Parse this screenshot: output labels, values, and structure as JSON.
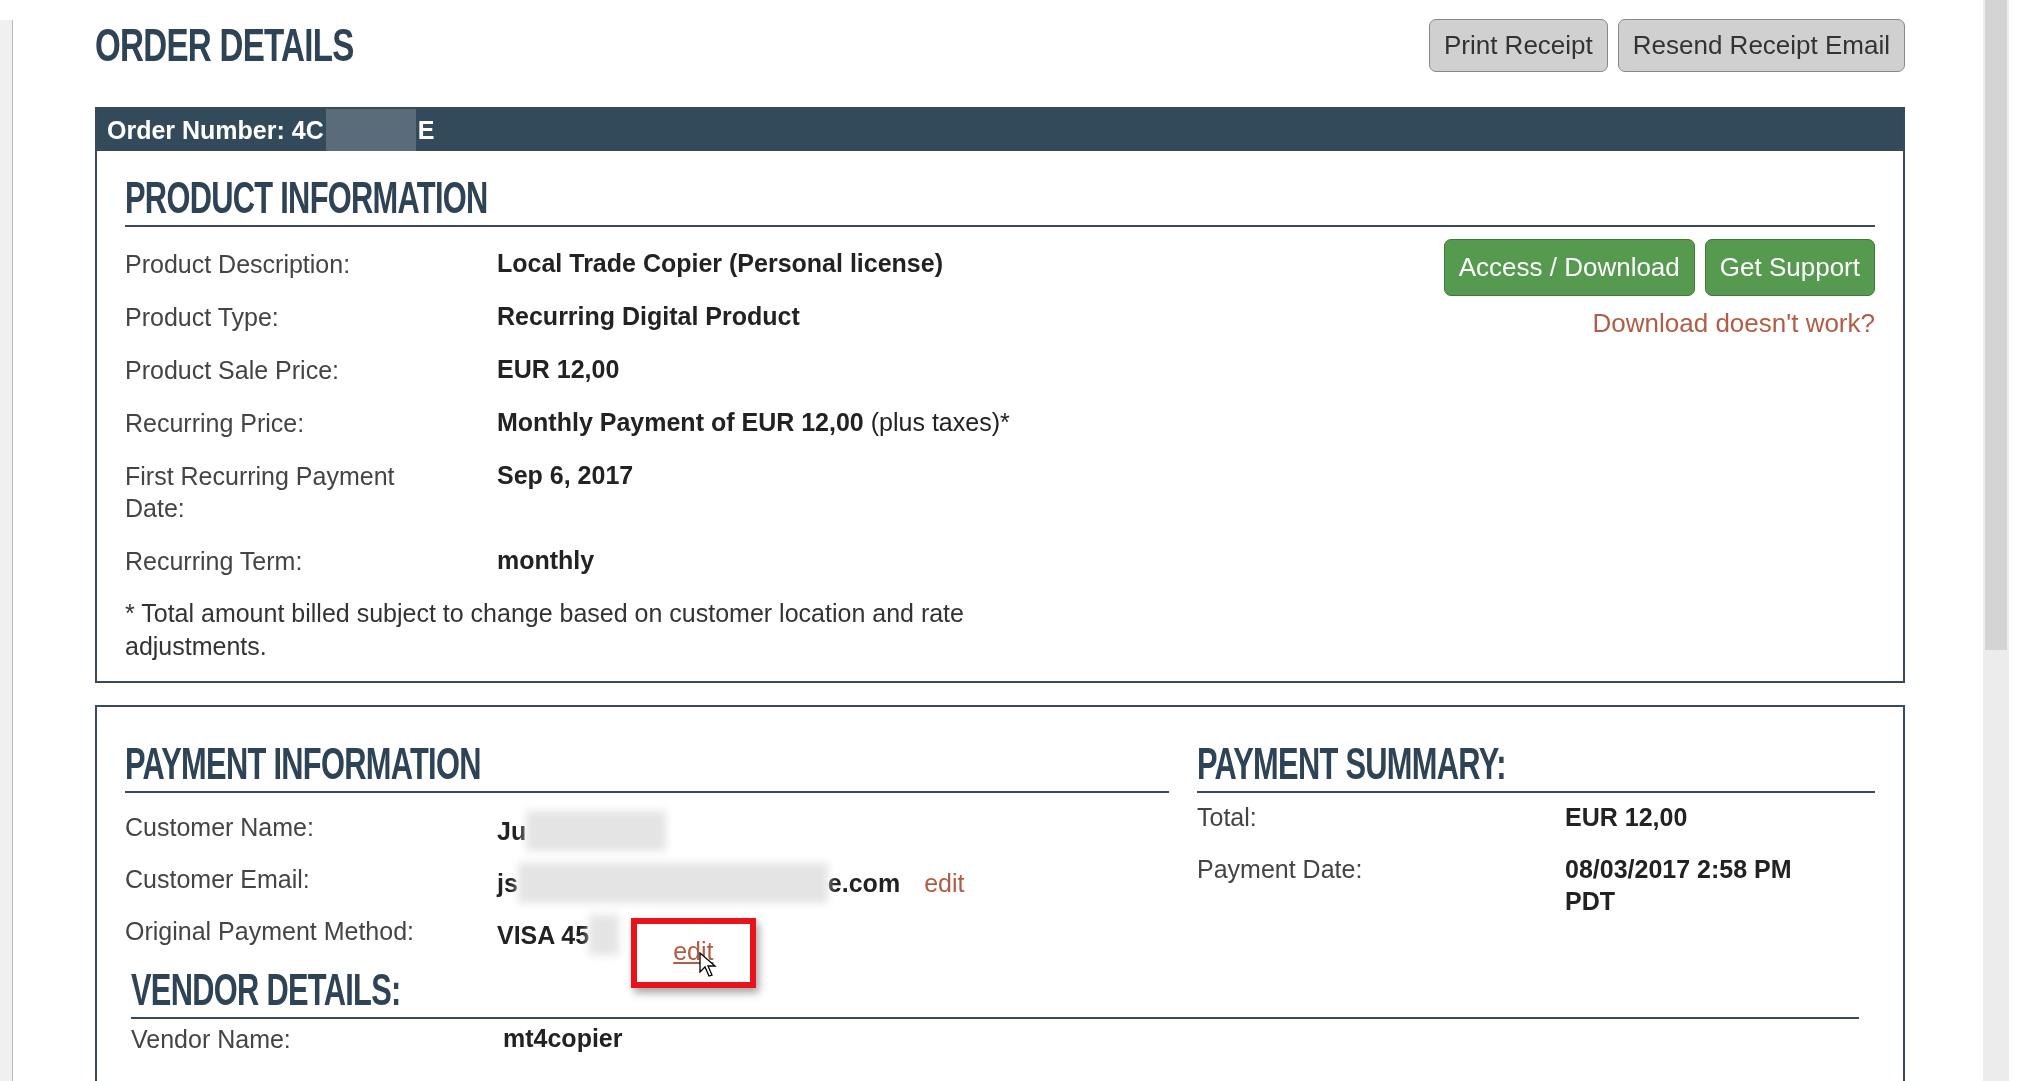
{
  "title": "ORDER DETAILS",
  "buttons": [
    "Print Receipt",
    "Resend Receipt Email"
  ],
  "order_bar": {
    "label": "Order Number: 4C",
    "redacted": true,
    "suffix": "E"
  },
  "product": {
    "heading": "PRODUCT INFORMATION",
    "rows": [
      {
        "label": "Product Description:",
        "value": "Local Trade Copier (Personal license)"
      },
      {
        "label": "Product Type:",
        "value": "Recurring Digital Product"
      },
      {
        "label": "Product Sale Price:",
        "value": "EUR 12,00"
      },
      {
        "label": "Recurring Price:",
        "value": "Monthly Payment of EUR 12,00",
        "note": "(plus taxes)*"
      },
      {
        "label": "First Recurring Payment Date:",
        "value": "Sep 6, 2017"
      },
      {
        "label": "Recurring Term:",
        "value": "monthly"
      }
    ],
    "actions": [
      "Access / Download",
      "Get Support"
    ],
    "help_link": "Download doesn't work?",
    "footnote": "* Total amount billed subject to change based on customer location and rate adjustments."
  },
  "payment": {
    "heading": "PAYMENT INFORMATION",
    "rows": [
      {
        "label": "Customer Name:",
        "value": "Ju",
        "redacted": true
      },
      {
        "label": "Customer Email:",
        "value": "js",
        "redacted": true,
        "value_end": "e.com",
        "edit_link": "edit",
        "highlighted": false
      },
      {
        "label": "Original Payment Method:",
        "value": "VISA 45",
        "redacted": true,
        "edit_link": "edit",
        "highlighted": true
      }
    ]
  },
  "summary": {
    "heading": "PAYMENT SUMMARY:",
    "rows": [
      {
        "label": "Total:",
        "value": "EUR 12,00"
      },
      {
        "label": "Payment Date:",
        "value": "08/03/2017 2:58 PM PDT"
      }
    ]
  },
  "vendor": {
    "heading": "VENDOR DETAILS:",
    "rows": [
      {
        "label": "Vendor Name:",
        "value": "mt4copier"
      }
    ]
  }
}
